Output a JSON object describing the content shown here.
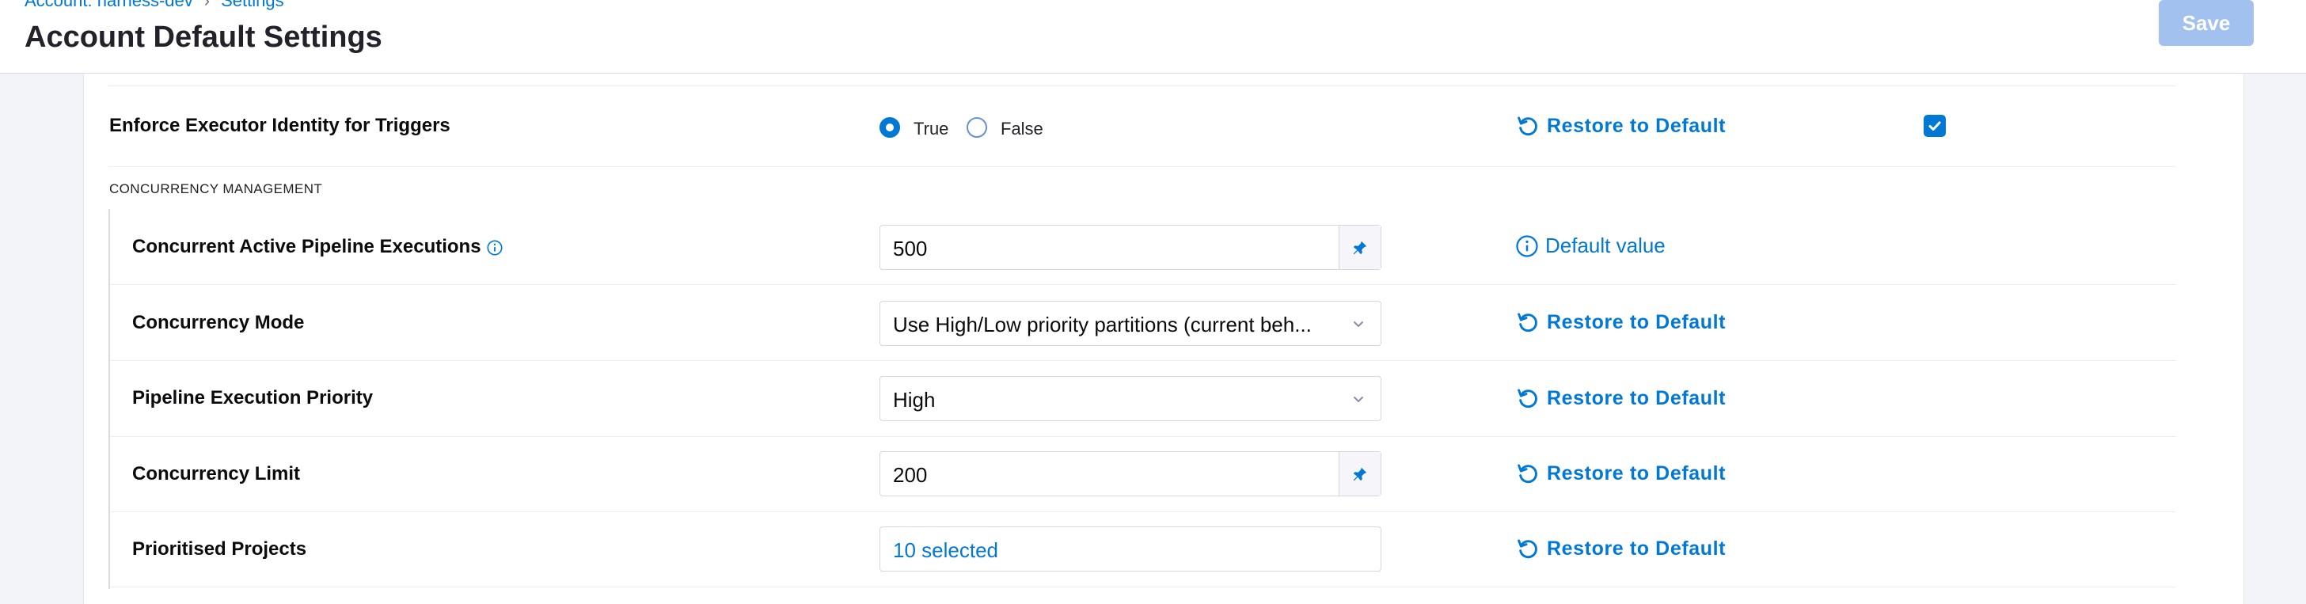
{
  "header": {
    "breadcrumb": {
      "account": "Account: harness-dev",
      "settings": "Settings"
    },
    "title": "Account Default Settings",
    "save_label": "Save"
  },
  "enforce": {
    "label": "Enforce Executor Identity for Triggers",
    "option_true": "True",
    "option_false": "False",
    "selected": "True",
    "restore_label": "Restore to Default",
    "checkbox_checked": true
  },
  "concurrency": {
    "section_title": "CONCURRENCY MANAGEMENT",
    "rows": [
      {
        "label": "Concurrent Active Pipeline Executions",
        "value": "500",
        "action": "Default value"
      },
      {
        "label": "Concurrency Mode",
        "value": "Use High/Low priority partitions (current beh...",
        "action": "Restore to Default"
      },
      {
        "label": "Pipeline Execution Priority",
        "value": "High",
        "action": "Restore to Default"
      },
      {
        "label": "Concurrency Limit",
        "value": "200",
        "action": "Restore to Default"
      },
      {
        "label": "Prioritised Projects",
        "value": "10 selected",
        "action": "Restore to Default"
      }
    ]
  },
  "colors": {
    "accent": "#0278d5",
    "save_disabled": "#a3c1ee",
    "background": "#f3f3fa"
  }
}
